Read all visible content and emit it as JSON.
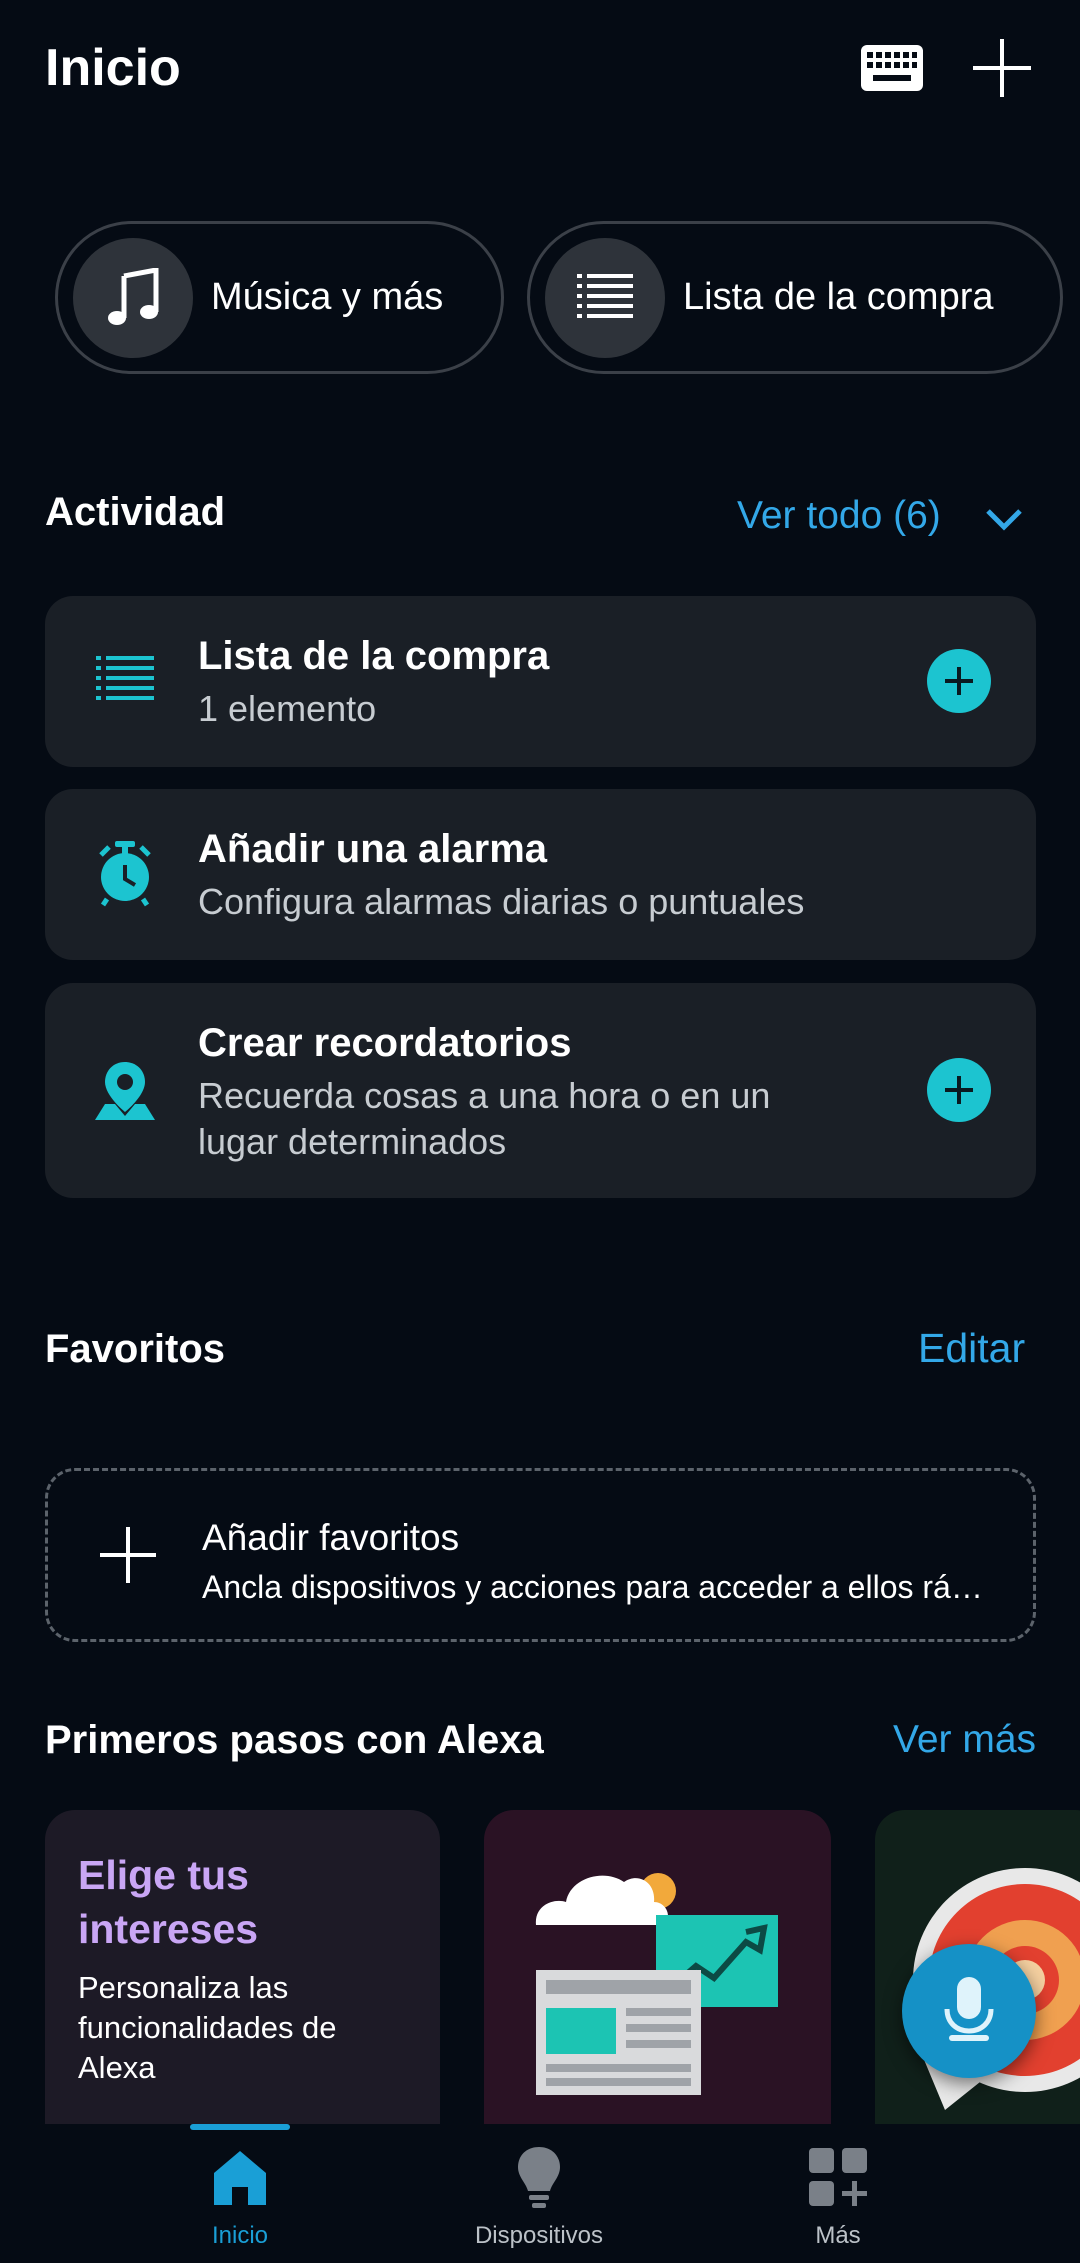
{
  "header": {
    "title": "Inicio",
    "keyboard_icon": "keyboard-icon",
    "add_icon": "plus-icon"
  },
  "quick_actions": [
    {
      "label": "Música y más",
      "icon": "music-note-icon"
    },
    {
      "label": "Lista de la compra",
      "icon": "list-icon"
    }
  ],
  "activity": {
    "title": "Actividad",
    "view_all": "Ver todo (6)",
    "cards": [
      {
        "title": "Lista de la compra",
        "subtitle": "1 elemento",
        "icon": "list-icon",
        "has_add": true
      },
      {
        "title": "Añadir una alarma",
        "subtitle": "Configura alarmas diarias o puntuales",
        "icon": "alarm-clock-icon",
        "has_add": false
      },
      {
        "title": "Crear recordatorios",
        "subtitle": "Recuerda cosas a una hora o en un lugar determinados",
        "icon": "location-pin-icon",
        "has_add": true
      }
    ]
  },
  "favorites": {
    "title": "Favoritos",
    "edit": "Editar",
    "add_title": "Añadir favoritos",
    "add_subtitle": "Ancla dispositivos y acciones para acceder a ellos rá…"
  },
  "getting_started": {
    "title": "Primeros pasos con Alexa",
    "see_more": "Ver más",
    "cards": [
      {
        "title": "Elige tus intereses",
        "description": "Personaliza las funcionalidades de Alexa"
      }
    ]
  },
  "bottom_nav": {
    "items": [
      {
        "label": "Inicio",
        "icon": "home-icon",
        "active": true
      },
      {
        "label": "Dispositivos",
        "icon": "lightbulb-icon",
        "active": false
      },
      {
        "label": "Más",
        "icon": "grid-plus-icon",
        "active": false
      }
    ]
  },
  "colors": {
    "background": "#050b14",
    "card": "#1a1f26",
    "accent_blue": "#33a8e8",
    "accent_teal": "#1cc4d0",
    "alexa_blue": "#1591c6",
    "interest_purple": "#c9a6f5"
  }
}
